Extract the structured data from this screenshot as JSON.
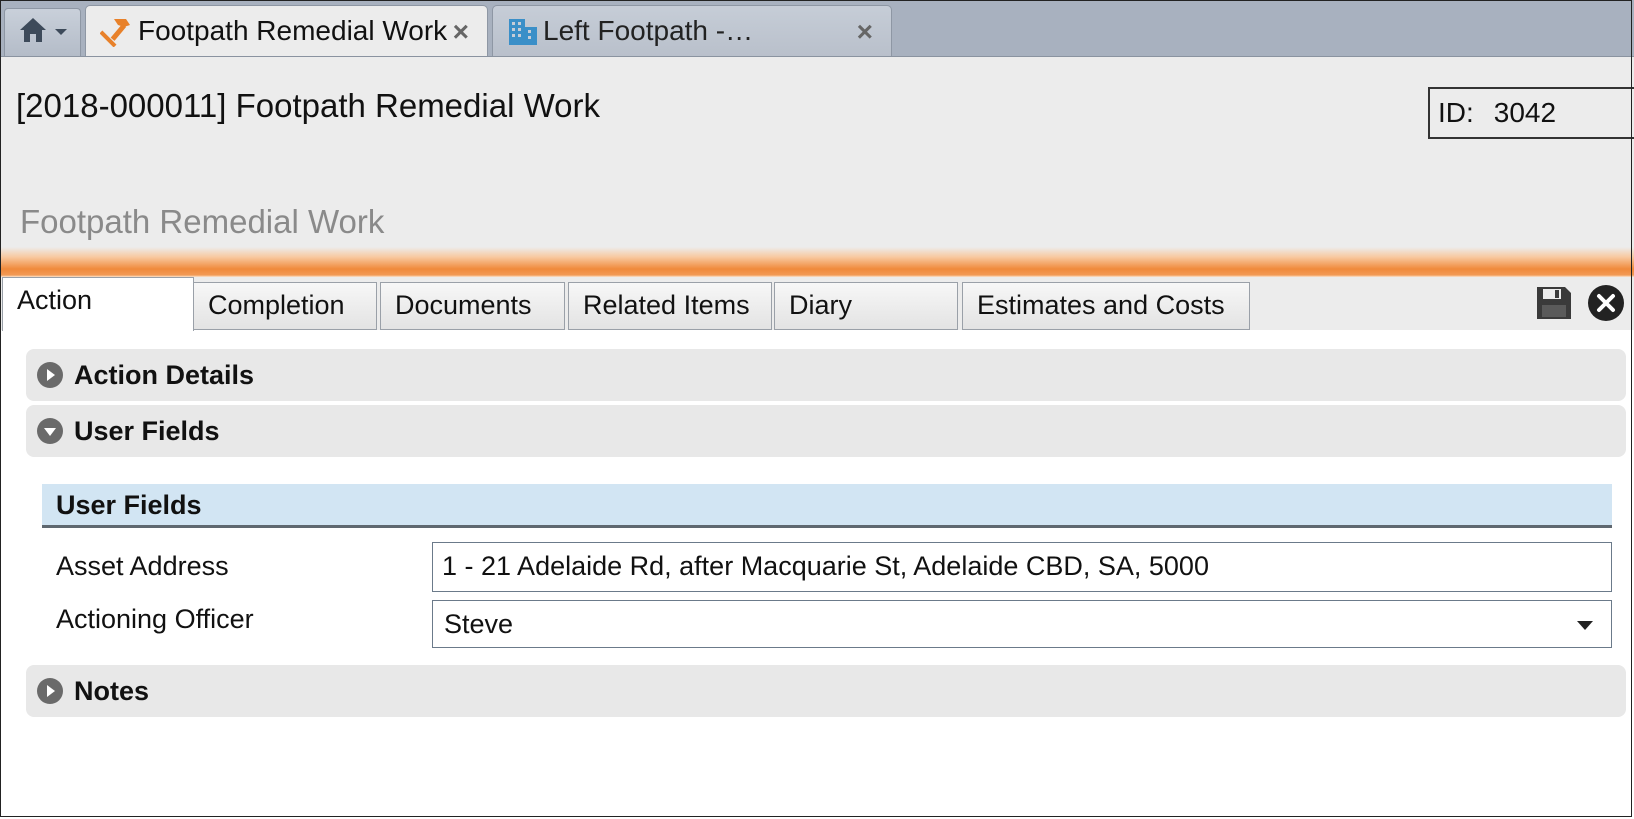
{
  "window_tabs": [
    {
      "label": "Footpath Remedial Work",
      "icon": "hammer-icon",
      "active": true
    },
    {
      "label": "Left Footpath -…",
      "icon": "building-icon",
      "active": false
    }
  ],
  "header": {
    "title": "[2018-000011] Footpath Remedial Work",
    "id_label": "ID:",
    "id_value": "3042",
    "subtitle": "Footpath Remedial Work"
  },
  "form_tabs": [
    "Action",
    "Completion",
    "Documents",
    "Related Items",
    "Diary",
    "Estimates and Costs"
  ],
  "sections": {
    "action_details": "Action Details",
    "user_fields": "User Fields",
    "notes": "Notes"
  },
  "user_fields": {
    "panel_title": "User Fields",
    "asset_address_label": "Asset Address",
    "asset_address_value": "1 - 21 Adelaide Rd,  after Macquarie St,  Adelaide CBD,  SA,  5000",
    "actioning_officer_label": "Actioning Officer",
    "actioning_officer_value": "Steve"
  },
  "colors": {
    "accent_orange": "#f08a3c",
    "panel_header_blue": "#d2e5f3",
    "tab_bar": "#a8b1bf"
  }
}
